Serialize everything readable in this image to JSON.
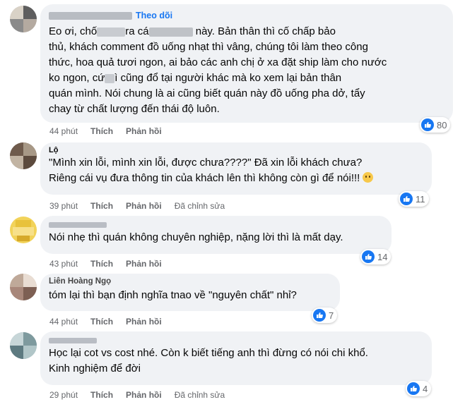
{
  "comments": [
    {
      "name_visible": "",
      "follow": "Theo dõi",
      "lines": [
        "Eo ơi, chố",
        "ra cá",
        "này. Bản thân thì cố chấp bảo",
        "thủ, khách comment đồ uống nhạt thì vâng, chúng tôi làm theo công",
        "thức, hoa quả tươi ngon, ai bảo các anh chị ở xa đặt ship làm cho nước",
        "ko ngon, cứ",
        "ì cũng đổ tại người khác mà ko xem lại bản thân",
        "quán mình. Nói chung là ai cũng biết quán này đồ uống pha dở, tẩy",
        "chay từ chất lượng đến thái độ luôn."
      ],
      "time": "44 phút",
      "like": "Thích",
      "reply": "Phản hồi",
      "edited": "",
      "reaction_count": "80"
    },
    {
      "name_visible": "Lộ",
      "lines": [
        "\"Mình xin lỗi, mình xin lỗi, được chưa????\" Đã xin lỗi khách chưa?",
        "Riêng cái vụ đưa thông tin của khách lên thì không còn gì để nói!!!"
      ],
      "time": "39 phút",
      "like": "Thích",
      "reply": "Phản hồi",
      "edited": "Đã chỉnh sửa",
      "reaction_count": "11"
    },
    {
      "name_visible": "",
      "lines": [
        "Nói nhẹ thì quán không chuyên nghiệp, nặng lời thì là mất dạy."
      ],
      "time": "43 phút",
      "like": "Thích",
      "reply": "Phản hồi",
      "edited": "",
      "reaction_count": "14"
    },
    {
      "name_visible": "Liên Hoàng Ngọ",
      "lines": [
        "tóm lại thì bạn định nghĩa tnao về \"nguyên chất\" nhỉ?"
      ],
      "time": "44 phút",
      "like": "Thích",
      "reply": "Phản hồi",
      "edited": "",
      "reaction_count": "7"
    },
    {
      "name_visible": "",
      "lines": [
        "Học lại cot vs cost nhé. Còn k biết tiếng anh thì đừng có nói chi khổ.",
        "Kinh nghiệm để đời"
      ],
      "time": "29 phút",
      "like": "Thích",
      "reply": "Phản hồi",
      "edited": "Đã chỉnh sửa",
      "reaction_count": "4"
    }
  ],
  "colors": {
    "bubble": "#f0f2f5",
    "link": "#1877f2",
    "meta": "#65676b",
    "like": "#1877f2"
  },
  "icons": [
    "like-icon",
    "sad-emoji-icon"
  ]
}
